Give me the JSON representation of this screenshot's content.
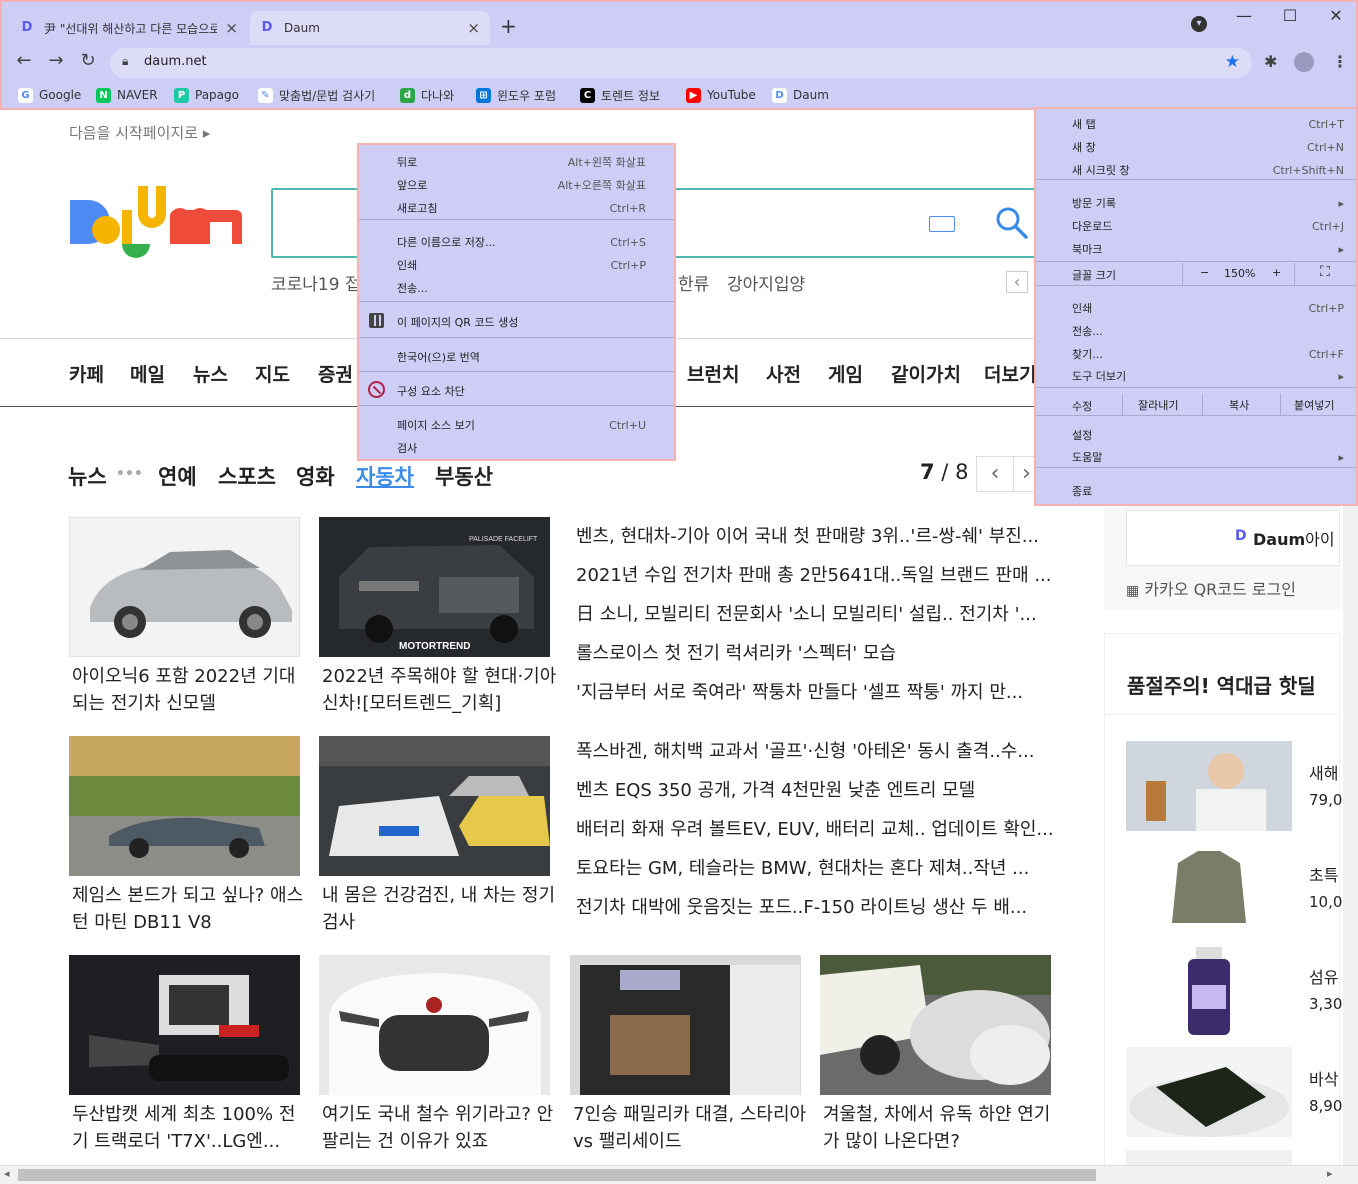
{
  "browser": {
    "tabs": [
      {
        "title": "尹 \"선대위 해산하고 다른 모습으로\"",
        "close": "×"
      },
      {
        "title": "Daum",
        "close": "×"
      }
    ],
    "new_tab": "+",
    "window": {
      "minimize": "—",
      "maximize": "☐",
      "close": "✕",
      "tab_search": "▾"
    },
    "nav": {
      "back": "←",
      "forward": "→",
      "reload": "↻"
    },
    "url": "daum.net",
    "bookmarks": [
      {
        "label": "Google",
        "icon": "G",
        "color": "#ffffff"
      },
      {
        "label": "NAVER",
        "icon": "N",
        "color": "#03c75a"
      },
      {
        "label": "Papago",
        "icon": "P",
        "color": "#1ec8a5"
      },
      {
        "label": "맞춤법/문법 검사기",
        "icon": "✎",
        "color": "#ffffff"
      },
      {
        "label": "다나와",
        "icon": "d",
        "color": "#2ca748"
      },
      {
        "label": "윈도우 포럼",
        "icon": "⊞",
        "color": "#0078d7"
      },
      {
        "label": "토렌트 정보",
        "icon": "C",
        "color": "#000000"
      },
      {
        "label": "YouTube",
        "icon": "▶",
        "color": "#ff0000"
      },
      {
        "label": "Daum",
        "icon": "D",
        "color": "#ffffff"
      }
    ]
  },
  "page": {
    "start_page_link": "다음을 시작페이지로 ▸",
    "logo": "Daum",
    "trending": [
      "코로나19 접",
      "한류",
      "강아지입양"
    ],
    "trend_prev": "‹",
    "gnb": [
      "카페",
      "메일",
      "뉴스",
      "지도",
      "증권",
      "브런치",
      "사전",
      "게임",
      "같이가치",
      "더보기"
    ],
    "news_tabs": [
      "뉴스",
      "•••",
      "연예",
      "스포츠",
      "영화",
      "자동차",
      "부동산"
    ],
    "pager": {
      "current": "7",
      "sep": " / ",
      "total": "8",
      "prev": "‹",
      "next": "›"
    },
    "cards": [
      {
        "caption": "아이오닉6 포함 2022년 기대되는 전기차 신모델"
      },
      {
        "caption": "2022년 주목해야 할 현대·기아 신차![모터트렌드_기획]"
      },
      {
        "caption": "제임스 본드가 되고 싶나? 애스턴 마틴 DB11 V8"
      },
      {
        "caption": "내 몸은 건강검진, 내 차는 정기검사"
      },
      {
        "caption": "두산밥캣 세계 최초 100% 전기 트랙로더 'T7X'..LG엔..."
      },
      {
        "caption": "여기도 국내 철수 위기라고? 안 팔리는 건 이유가 있죠"
      },
      {
        "caption": "7인승 패밀리카 대결, 스타리아 vs 팰리세이드"
      },
      {
        "caption": "겨울철, 차에서 유독 하얀 연기가 많이 나온다면?"
      }
    ],
    "headlines": [
      "벤츠, 현대차-기아 이어 국내 첫 판매량 3위..'르-쌍-쉐' 부진...",
      "2021년 수입 전기차 판매 총 2만5641대..독일 브랜드 판매 ...",
      "日 소니, 모빌리티 전문회사 '소니 모빌리티' 설립.. 전기차 '...",
      "롤스로이스 첫 전기 럭셔리카 '스펙터' 모습",
      "'지금부터 서로 죽여라' 짝퉁차 만들다 '셀프 짝퉁' 까지 만...",
      "폭스바겐, 해치백 교과서 '골프'·신형 '아테온' 동시 출격..수...",
      "벤츠 EQS 350 공개, 가격 4천만원 낮춘 엔트리 모델",
      "배터리 화재 우려 볼트EV, EUV, 배터리 교체.. 업데이트 확인...",
      "토요타는 GM, 테슬라는 BMW, 현대차는 혼다 제쳐..작년 ...",
      "전기차 대박에 웃음짓는 포드..F-150 라이트닝 생산 두 배..."
    ],
    "side": {
      "login_brand": "Daum",
      "login_suffix": "아이",
      "qr_login": "카카오 QR코드 로그인",
      "deal_title": "품절주의! 역대급 핫딜",
      "deals": [
        {
          "name": "새해",
          "price": "79,0("
        },
        {
          "name": "초특",
          "price": "10,0("
        },
        {
          "name": "섬유",
          "price": "3,30"
        },
        {
          "name": "바삭",
          "price": "8,90"
        }
      ]
    }
  },
  "context_menu": {
    "items": [
      {
        "label": "뒤로",
        "shortcut": "Alt+왼쪽 화살표"
      },
      {
        "label": "앞으로",
        "shortcut": "Alt+오른쪽 화살표"
      },
      {
        "label": "새로고침",
        "shortcut": "Ctrl+R"
      },
      {
        "label": "다른 이름으로 저장...",
        "shortcut": "Ctrl+S"
      },
      {
        "label": "인쇄",
        "shortcut": "Ctrl+P"
      },
      {
        "label": "전송...",
        "shortcut": ""
      },
      {
        "label": "이 페이지의 QR 코드 생성",
        "shortcut": ""
      },
      {
        "label": "한국어(으)로 번역",
        "shortcut": ""
      },
      {
        "label": "구성 요소 차단",
        "shortcut": ""
      },
      {
        "label": "페이지 소스 보기",
        "shortcut": "Ctrl+U"
      },
      {
        "label": "검사",
        "shortcut": ""
      }
    ]
  },
  "chrome_menu": {
    "items": [
      {
        "label": "새 탭",
        "shortcut": "Ctrl+T"
      },
      {
        "label": "새 창",
        "shortcut": "Ctrl+N"
      },
      {
        "label": "새 시크릿 창",
        "shortcut": "Ctrl+Shift+N"
      },
      {
        "label": "방문 기록",
        "shortcut": "▸"
      },
      {
        "label": "다운로드",
        "shortcut": "Ctrl+J"
      },
      {
        "label": "북마크",
        "shortcut": "▸"
      },
      {
        "label": "인쇄",
        "shortcut": "Ctrl+P"
      },
      {
        "label": "전송...",
        "shortcut": ""
      },
      {
        "label": "찾기...",
        "shortcut": "Ctrl+F"
      },
      {
        "label": "도구 더보기",
        "shortcut": "▸"
      },
      {
        "label": "설정",
        "shortcut": ""
      },
      {
        "label": "도움말",
        "shortcut": "▸"
      },
      {
        "label": "종료",
        "shortcut": ""
      }
    ],
    "zoom": {
      "label": "글꼴 크기",
      "minus": "−",
      "value": "150%",
      "plus": "+",
      "fullscreen": "⛶"
    },
    "edit": {
      "label": "수정",
      "cut": "잘라내기",
      "copy": "복사",
      "paste": "붙여넣기"
    }
  },
  "scrollbar": {
    "left": "◂",
    "right": "▸"
  }
}
